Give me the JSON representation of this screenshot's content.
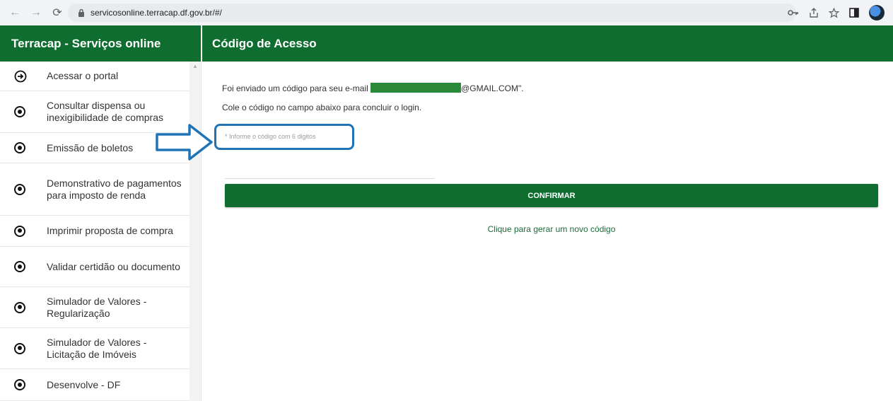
{
  "browser": {
    "url": "servicosonline.terracap.df.gov.br/#/",
    "back_icon": "arrow-left-icon",
    "forward_icon": "arrow-right-icon",
    "reload_icon": "reload-icon"
  },
  "sidebar": {
    "title": "Terracap - Serviços online",
    "items": [
      {
        "label": "Acessar o portal",
        "icon": "login-icon"
      },
      {
        "label": "Consultar dispensa ou inexigibilidade de compras",
        "icon": "radio-dot-icon"
      },
      {
        "label": "Emissão de boletos",
        "icon": "radio-dot-icon"
      },
      {
        "label": "Demonstrativo de pagamentos para imposto de renda",
        "icon": "radio-dot-icon"
      },
      {
        "label": "Imprimir proposta de compra",
        "icon": "radio-dot-icon"
      },
      {
        "label": "Validar certidão ou documento",
        "icon": "radio-dot-icon"
      },
      {
        "label": "Simulador de Valores - Regularização",
        "icon": "radio-dot-icon"
      },
      {
        "label": "Simulador de Valores - Licitação de Imóveis",
        "icon": "radio-dot-icon"
      },
      {
        "label": "Desenvolve - DF",
        "icon": "radio-dot-icon"
      }
    ]
  },
  "main": {
    "title": "Código de Acesso",
    "message_prefix": "Foi enviado um código para seu e-mail",
    "message_suffix": "@GMAIL.COM\".",
    "instruction": "Cole o código no campo abaixo para concluir o login.",
    "code_placeholder": "* Informe o código com 6 digitos",
    "confirm_label": "CONFIRMAR",
    "new_code_link": "Clique para gerar um novo código"
  },
  "colors": {
    "brand_green": "#0f6d30",
    "highlight_blue": "#1f73b7"
  }
}
